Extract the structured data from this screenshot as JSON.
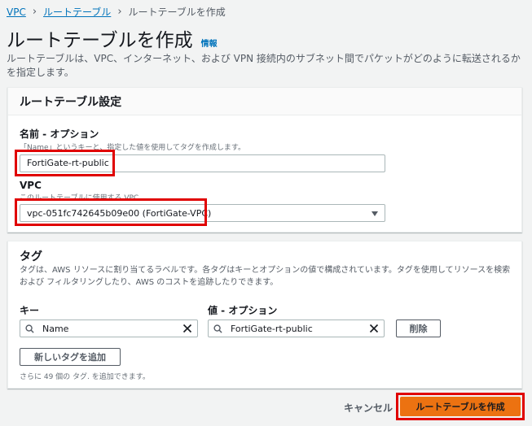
{
  "breadcrumb": {
    "items": [
      "VPC",
      "ルートテーブル"
    ],
    "current": "ルートテーブルを作成"
  },
  "page": {
    "title": "ルートテーブルを作成",
    "info": "情報",
    "description": "ルートテーブルは、VPC、インターネット、および VPN 接続内のサブネット間でパケットがどのように転送されるかを指定します。"
  },
  "settings": {
    "header": "ルートテーブル設定",
    "name_label": "名前 - オプション",
    "name_hint": "「Name」というキーと、指定した値を使用してタグを作成します。",
    "name_value": "FortiGate-rt-public",
    "vpc_label": "VPC",
    "vpc_hint": "このルートテーブルに使用する VPC。",
    "vpc_value": "vpc-051fc742645b09e00 (FortiGate-VPC)"
  },
  "tags": {
    "title": "タグ",
    "description": "タグは、AWS リソースに割り当てるラベルです。各タグはキーとオプションの値で構成されています。タグを使用してリソースを検索および フィルタリングしたり、AWS のコストを追跡したりできます。",
    "key_label": "キー",
    "value_label": "値 - オプション",
    "key_value": "Name",
    "value_value": "FortiGate-rt-public",
    "remove_label": "削除",
    "add_label": "新しいタグを追加",
    "remaining": "さらに 49 個の タグ. を追加できます。"
  },
  "footer": {
    "cancel": "キャンセル",
    "create": "ルートテーブルを作成"
  },
  "colors": {
    "link": "#0073bb",
    "primary": "#ec7211",
    "highlight": "#e00000"
  }
}
